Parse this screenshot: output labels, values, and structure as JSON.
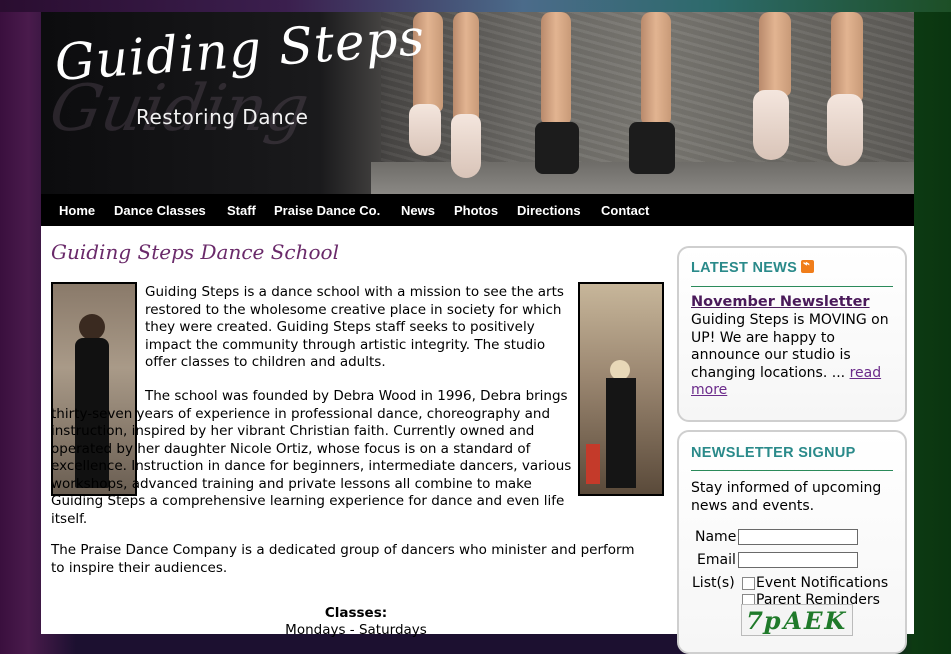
{
  "topstrip": {
    "tiny_text": ""
  },
  "header": {
    "logo_title": "Guiding Steps",
    "logo_subtitle": "Restoring Dance",
    "logo_ghost": "Guiding"
  },
  "nav": {
    "items": [
      {
        "label": "Home"
      },
      {
        "label": "Dance Classes"
      },
      {
        "label": "Staff"
      },
      {
        "label": "Praise Dance Co."
      },
      {
        "label": "News"
      },
      {
        "label": "Photos"
      },
      {
        "label": "Directions"
      },
      {
        "label": "Contact"
      }
    ]
  },
  "main": {
    "title": "Guiding Steps Dance School",
    "paragraphs": [
      "Guiding Steps is a dance school with a mission to see the arts restored to the wholesome creative place in society for which they were created. Guiding Steps staff seeks to positively impact the community through artistic integrity. The studio offer classes to children and adults.",
      "The school was founded by Debra Wood in 1996, Debra brings thirty-seven years of experience in professional dance, choreography and instruction, inspired by her vibrant Christian faith. Currently owned and operated by her daughter Nicole Ortiz, whose focus is on a standard of excellence. Instruction in dance for beginners, intermediate dancers, various workshops, advanced training and private lessons all combine to make Guiding Steps a comprehensive learning experience for dance and even life itself.",
      "The Praise Dance Company is a dedicated group of dancers who minister and perform to inspire their audiences."
    ],
    "classes_heading": "Classes:",
    "classes_days": "Mondays - Saturdays"
  },
  "sidebar": {
    "news": {
      "heading": "LATEST NEWS",
      "item_title": "November Newsletter",
      "item_text": "Guiding Steps is MOVING on UP!  We are happy to announce our studio is changing locations. ...",
      "read_more": "read more"
    },
    "signup": {
      "heading": "NEWSLETTER SIGNUP",
      "intro": "Stay informed of upcoming news and events.",
      "name_label": "Name",
      "email_label": "Email",
      "lists_label": "List(s)",
      "option1": "Event Notifications",
      "option2": "Parent Reminders",
      "captcha_text": "7pAEK"
    }
  },
  "colors": {
    "accent_purple": "#6a2a6a",
    "accent_teal": "#2a8a8a",
    "nav_bg": "#000000",
    "rss_orange": "#f07d1a"
  }
}
